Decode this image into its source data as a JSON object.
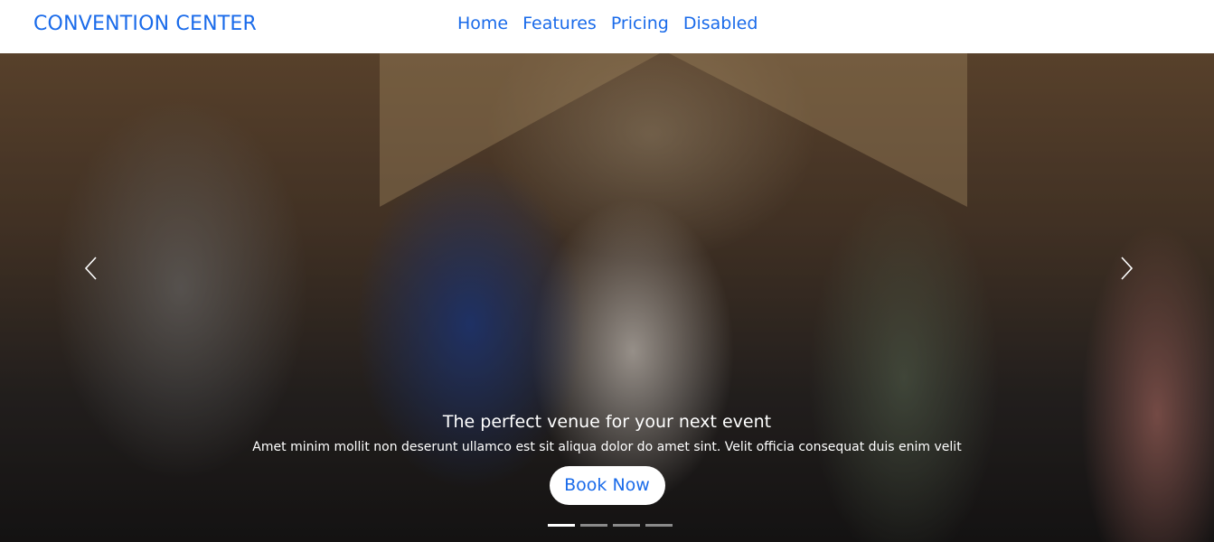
{
  "navbar": {
    "brand": "CONVENTION CENTER",
    "links": [
      "Home",
      "Features",
      "Pricing",
      "Disabled"
    ]
  },
  "hero": {
    "caption_title": "The perfect venue for your next event",
    "caption_text": "Amet minim mollit non deserunt ullamco est sit aliqua dolor do amet sint. Velit officia consequat duis enim velit",
    "button_label": "Book Now",
    "prev_icon": "chevron-left-icon",
    "next_icon": "chevron-right-icon",
    "slide_count": 4,
    "active_slide": 1
  },
  "colors": {
    "accent": "#1a6bea",
    "nav_background": "#ffffff"
  }
}
